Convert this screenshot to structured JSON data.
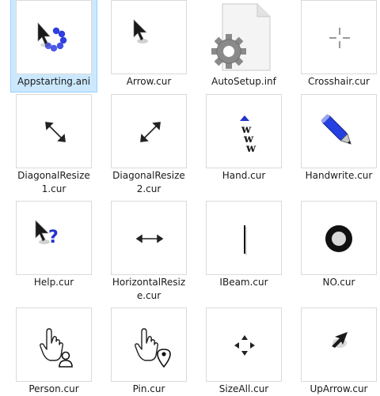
{
  "files": [
    {
      "name": "Appstarting.ani",
      "icon": "appstarting-cursor-icon",
      "selected": true
    },
    {
      "name": "Arrow.cur",
      "icon": "arrow-cursor-icon"
    },
    {
      "name": "AutoSetup.inf",
      "icon": "settings-file-icon"
    },
    {
      "name": "Crosshair.cur",
      "icon": "crosshair-cursor-icon"
    },
    {
      "name": "DiagonalResize1.cur",
      "line1": "DiagonalResize",
      "line2": "1.cur",
      "icon": "diagonal-resize-1-cursor-icon"
    },
    {
      "name": "DiagonalResize2.cur",
      "line1": "DiagonalResize",
      "line2": "2.cur",
      "icon": "diagonal-resize-2-cursor-icon"
    },
    {
      "name": "Hand.cur",
      "icon": "hand-cursor-icon"
    },
    {
      "name": "Handwrite.cur",
      "icon": "pen-cursor-icon"
    },
    {
      "name": "Help.cur",
      "icon": "help-cursor-icon"
    },
    {
      "name": "HorizontalResize.cur",
      "line1": "HorizontalResiz",
      "line2": "e.cur",
      "icon": "horizontal-resize-cursor-icon"
    },
    {
      "name": "IBeam.cur",
      "icon": "ibeam-cursor-icon"
    },
    {
      "name": "NO.cur",
      "icon": "unavailable-cursor-icon"
    },
    {
      "name": "Person.cur",
      "icon": "person-cursor-icon"
    },
    {
      "name": "Pin.cur",
      "icon": "pin-cursor-icon"
    },
    {
      "name": "SizeAll.cur",
      "icon": "size-all-cursor-icon"
    },
    {
      "name": "UpArrow.cur",
      "icon": "up-arrow-cursor-icon"
    }
  ],
  "colors": {
    "selection_fill": "#cce8ff",
    "selection_border": "#99d1ff",
    "thumb_border": "#dadada",
    "accent_blue": "#2233cc"
  }
}
